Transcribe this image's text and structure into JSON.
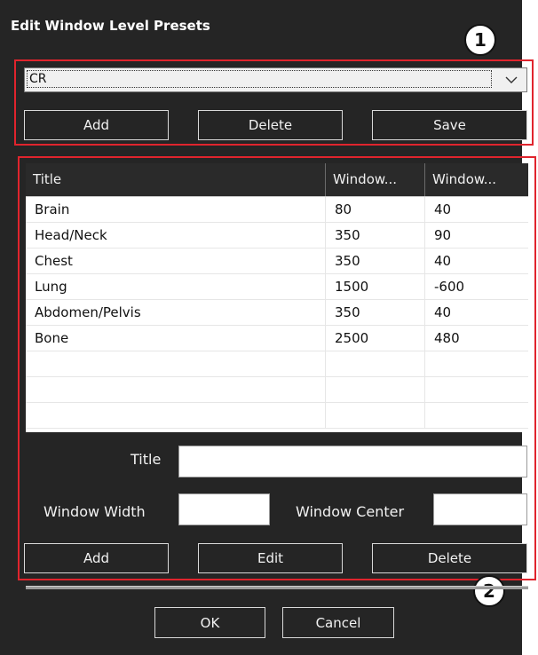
{
  "dialog": {
    "title": "Edit Window Level Presets",
    "close_glyph": "✕"
  },
  "callouts": [
    "1",
    "2"
  ],
  "presets": {
    "selected": "CR",
    "add_label": "Add",
    "delete_label": "Delete",
    "save_label": "Save"
  },
  "table": {
    "columns": [
      "Title",
      "Window...",
      "Window..."
    ],
    "rows": [
      [
        "Brain",
        "80",
        "40"
      ],
      [
        "Head/Neck",
        "350",
        "90"
      ],
      [
        "Chest",
        "350",
        "40"
      ],
      [
        "Lung",
        "1500",
        "-600"
      ],
      [
        "Abdomen/Pelvis",
        "350",
        "40"
      ],
      [
        "Bone",
        "2500",
        "480"
      ]
    ]
  },
  "form": {
    "title_label": "Title",
    "title_value": "",
    "width_label": "Window Width",
    "width_value": "",
    "center_label": "Window Center",
    "center_value": "",
    "add_label": "Add",
    "edit_label": "Edit",
    "delete_label": "Delete"
  },
  "footer": {
    "ok_label": "OK",
    "cancel_label": "Cancel"
  },
  "colors": {
    "background": "#252525",
    "highlight": "#e0242d"
  }
}
